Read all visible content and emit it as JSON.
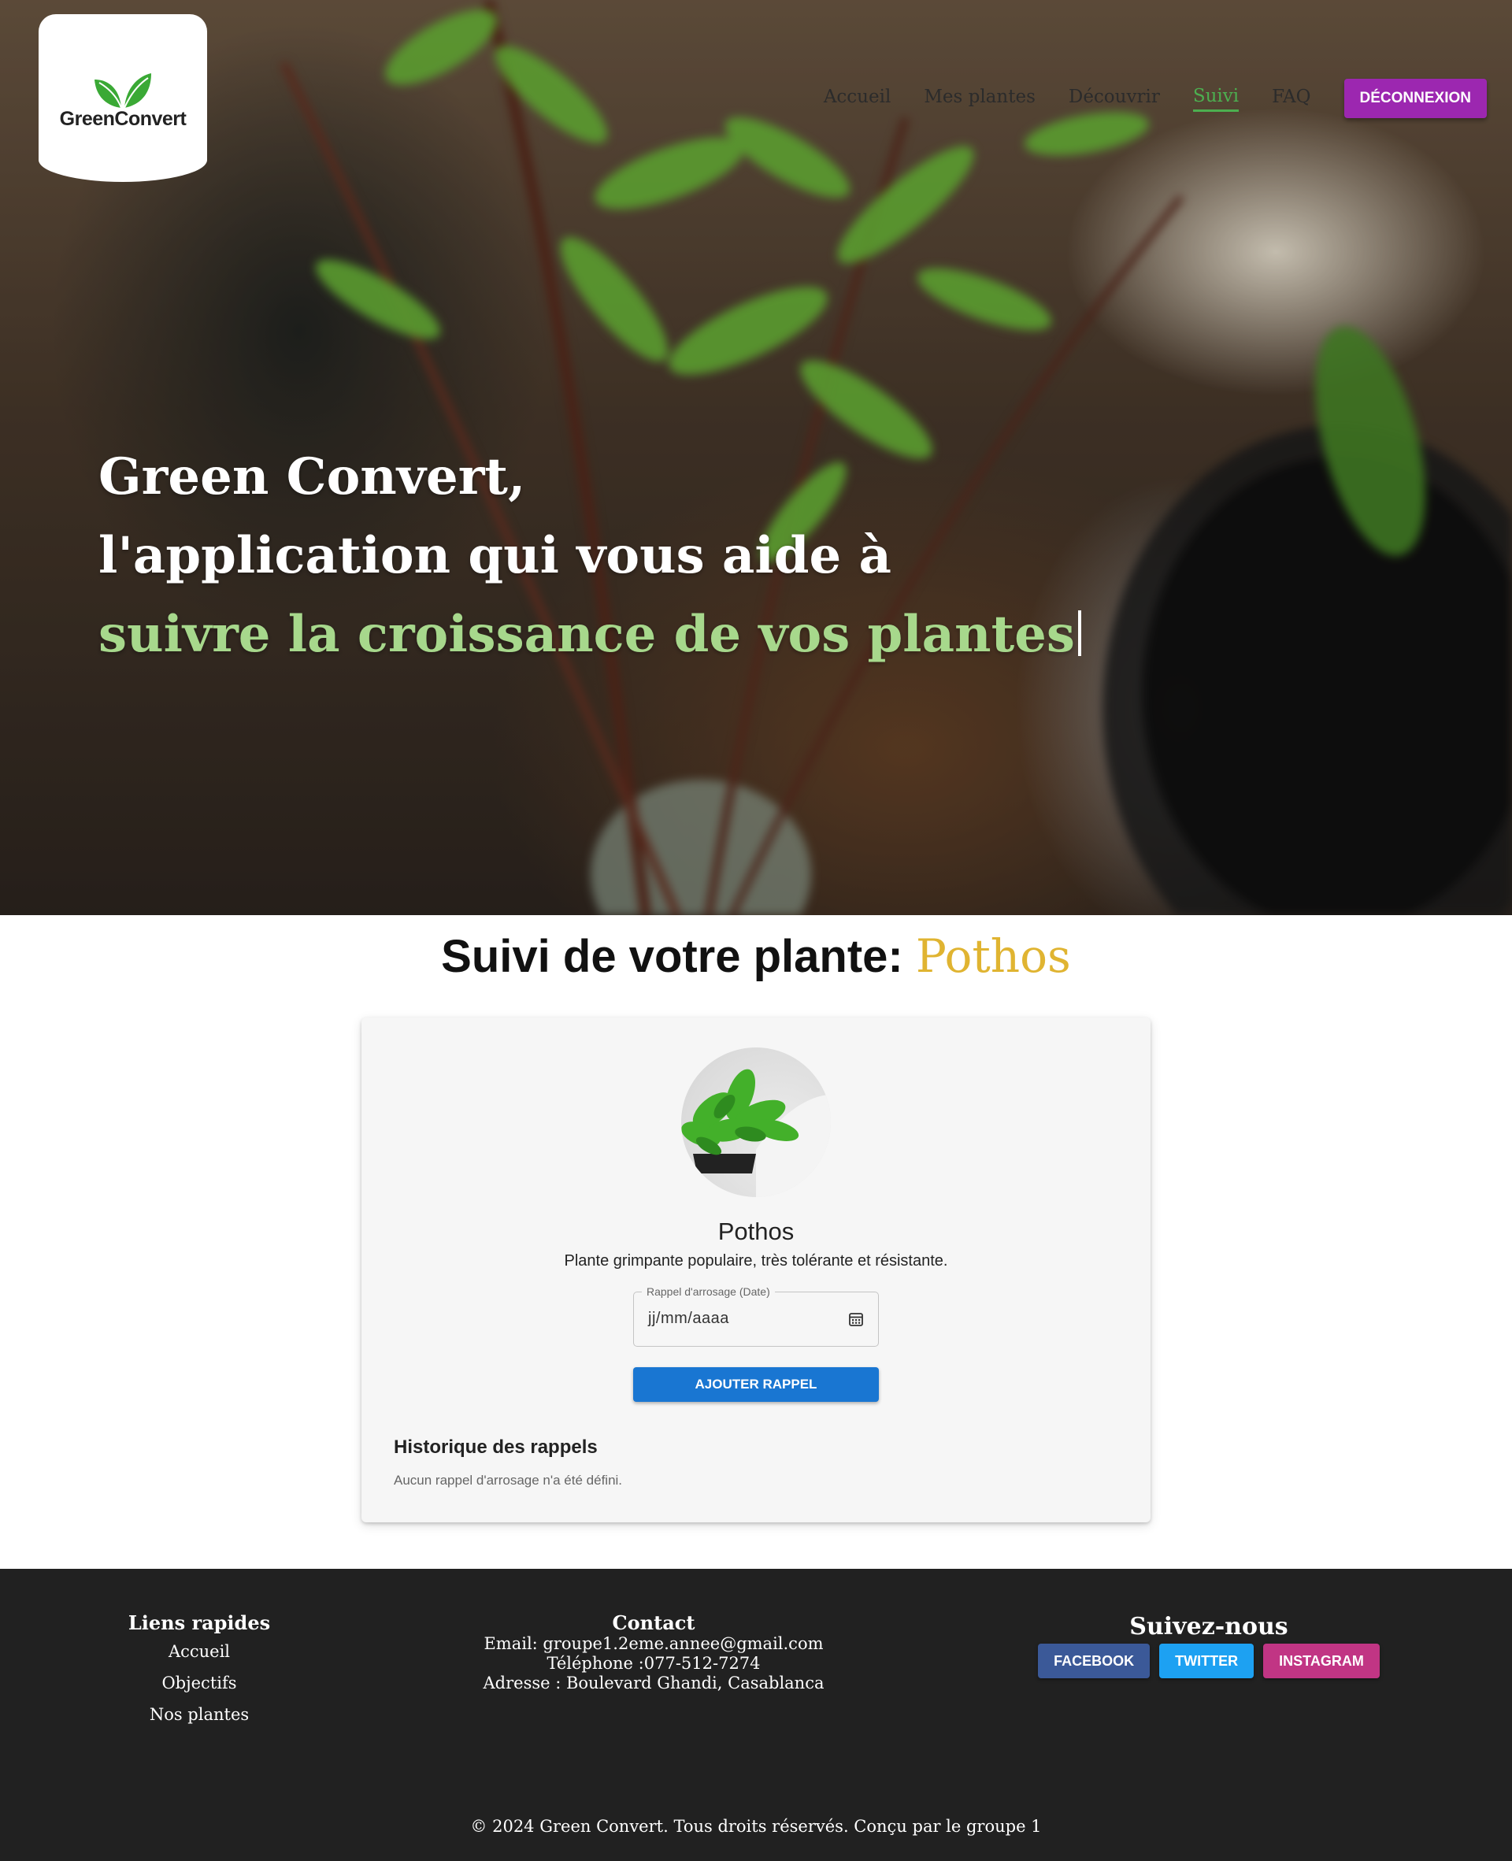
{
  "brand": {
    "logo_text": "GreenConvert"
  },
  "nav": {
    "items": [
      {
        "label": "Accueil",
        "active": false
      },
      {
        "label": "Mes plantes",
        "active": false
      },
      {
        "label": "Découvrir",
        "active": false
      },
      {
        "label": "Suivi",
        "active": true
      },
      {
        "label": "FAQ",
        "active": false
      }
    ],
    "logout_label": "DÉCONNEXION"
  },
  "hero": {
    "line1": "Green Convert,",
    "line2": "l'application qui vous aide à",
    "line3": "suivre la croissance de vos plantes"
  },
  "tracking": {
    "title_prefix": "Suivi de votre plante:",
    "plant_name": "Pothos",
    "card": {
      "name": "Pothos",
      "description": "Plante grimpante populaire, très tolérante et résistante.",
      "date_field_label": "Rappel d'arrosage (Date)",
      "date_field_value": "jj/mm/aaaa",
      "add_button_label": "AJOUTER RAPPEL",
      "history_title": "Historique des rappels",
      "history_empty": "Aucun rappel d'arrosage n'a été défini."
    }
  },
  "footer": {
    "links_heading": "Liens rapides",
    "links": [
      "Accueil",
      "Objectifs",
      "Nos plantes"
    ],
    "contact_heading": "Contact",
    "contact_email": "Email: groupe1.2eme.annee@gmail.com",
    "contact_phone": "Téléphone :077-512-7274",
    "contact_address": "Adresse : Boulevard Ghandi, Casablanca",
    "social_heading": "Suivez-nous",
    "social": [
      {
        "label": "FACEBOOK",
        "color": "#3b5998"
      },
      {
        "label": "TWITTER",
        "color": "#1da1f2"
      },
      {
        "label": "INSTAGRAM",
        "color": "#c13584"
      }
    ],
    "copyright": "© 2024 Green Convert. Tous droits réservés. Conçu par le groupe 1"
  },
  "colors": {
    "active_nav": "#4caf50",
    "logout_button": "#9c27b0",
    "plant_name_accent": "#e0b431",
    "primary_button": "#1976d2",
    "hero_accent": "#a7d88c",
    "footer_bg": "#212121"
  },
  "icons": {
    "calendar": "calendar-icon",
    "logo": "leaf-icon"
  }
}
